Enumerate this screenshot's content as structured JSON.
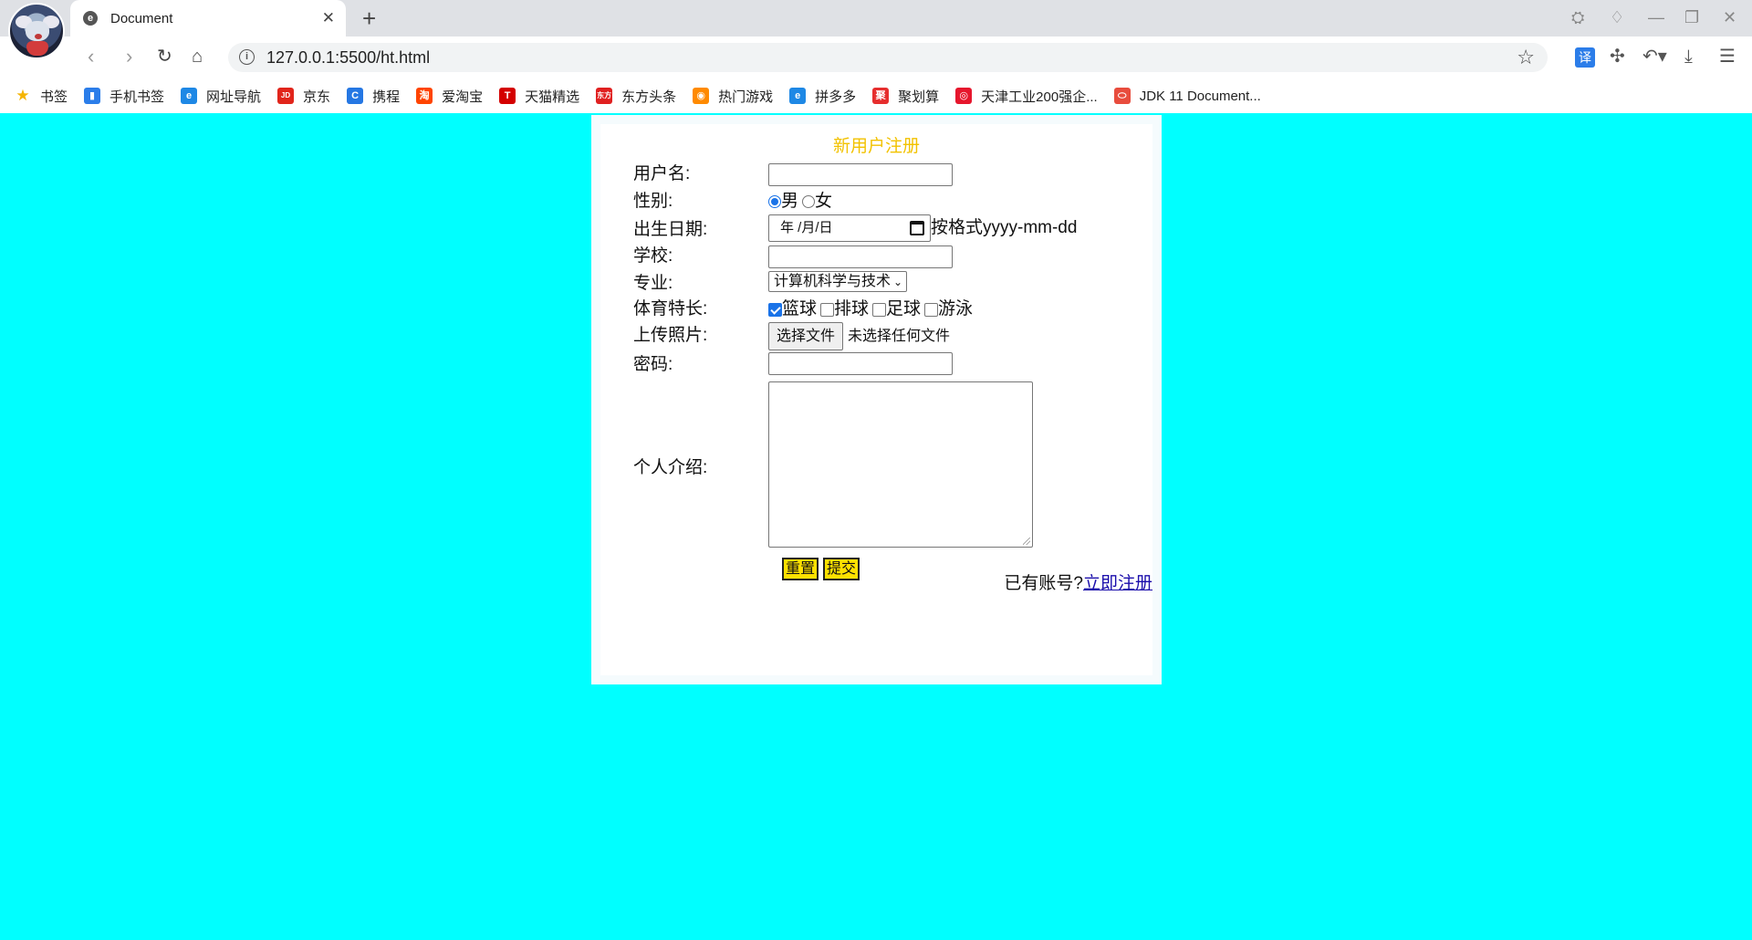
{
  "browser": {
    "tab_title": "Document",
    "tab_favicon": "e",
    "url": "127.0.0.1:5500/ht.html",
    "translate_label": "译",
    "bookmarks": [
      {
        "label": "书签",
        "icon": "star-icon",
        "color": "#f5b400",
        "glyph": "★"
      },
      {
        "label": "手机书签",
        "icon": "phone-icon",
        "color": "#2b7de9",
        "glyph": "▮"
      },
      {
        "label": "网址导航",
        "icon": "browser-e-icon",
        "color": "#1e88e5",
        "glyph": "e"
      },
      {
        "label": "京东",
        "icon": "jd-icon",
        "color": "#e1251b",
        "glyph": "JD"
      },
      {
        "label": "携程",
        "icon": "ctrip-icon",
        "color": "#2577e3",
        "glyph": "C"
      },
      {
        "label": "爱淘宝",
        "icon": "taobao-icon",
        "color": "#ff4400",
        "glyph": "淘"
      },
      {
        "label": "天猫精选",
        "icon": "tmall-icon",
        "color": "#d40000",
        "glyph": "T"
      },
      {
        "label": "东方头条",
        "icon": "dftt-icon",
        "color": "#e02020",
        "glyph": "东方"
      },
      {
        "label": "热门游戏",
        "icon": "game-icon",
        "color": "#ff8a00",
        "glyph": "◉"
      },
      {
        "label": "拼多多",
        "icon": "browser-e-icon",
        "color": "#1e88e5",
        "glyph": "e"
      },
      {
        "label": "聚划算",
        "icon": "juhuasuan-icon",
        "color": "#e62e2e",
        "glyph": "聚"
      },
      {
        "label": "天津工业200强企...",
        "icon": "weibo-icon",
        "color": "#e6162d",
        "glyph": "◎"
      },
      {
        "label": "JDK 11 Document...",
        "icon": "oracle-icon",
        "color": "#e84c3d",
        "glyph": "⬭"
      }
    ]
  },
  "form": {
    "title": "新用户注册",
    "username_label": "用户名:",
    "gender_label": "性别:",
    "gender_options": [
      "男",
      "女"
    ],
    "gender_selected": "男",
    "birthdate_label": "出生日期:",
    "birthdate_placeholder": "年 /月/日",
    "birthdate_hint": "按格式yyyy-mm-dd",
    "school_label": "学校:",
    "major_label": "专业:",
    "major_selected": "计算机科学与技术",
    "sports_label": "体育特长:",
    "sports_options": [
      "篮球",
      "排球",
      "足球",
      "游泳"
    ],
    "sports_checked": [
      "篮球"
    ],
    "photo_label": "上传照片:",
    "file_button": "选择文件",
    "file_status": "未选择任何文件",
    "password_label": "密码:",
    "intro_label": "个人介绍:",
    "reset_button": "重置",
    "submit_button": "提交",
    "have_account_text": "已有账号?",
    "register_link": "立即注册"
  },
  "colors": {
    "page_background": "#00ffff",
    "title_color": "#f2c200",
    "button_yellow": "#ffe100"
  }
}
